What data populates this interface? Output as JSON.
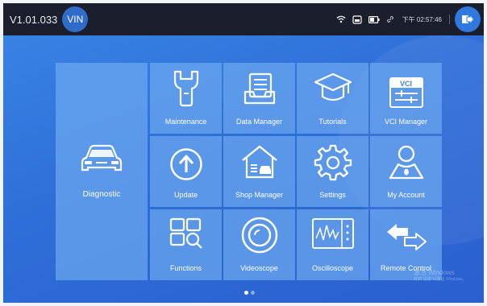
{
  "header": {
    "version": "V1.01.033",
    "vin_label": "VIN",
    "clock": "下午 02:57:46",
    "status_icons": [
      "wifi-icon",
      "storage-icon",
      "battery-icon",
      "link-icon"
    ],
    "exit_icon": "exit-icon"
  },
  "tiles": {
    "diagnostic": "Diagnostic",
    "maintenance": "Maintenance",
    "data_manager": "Data Manager",
    "tutorials": "Tutorials",
    "vci_manager": "VCI Manager",
    "vci_badge": "VCI",
    "update": "Update",
    "shop_manager": "Shop Manager",
    "settings": "Settings",
    "my_account": "My Account",
    "functions": "Functions",
    "videoscope": "Videoscope",
    "oscilloscope": "Oscilloscope",
    "remote_control": "Remote Control"
  },
  "pager": {
    "total_pages": 2,
    "current_page": 1
  },
  "watermark": {
    "line1": "激活 Windows",
    "line2": "转到\"设置\"以激活 Windows。"
  },
  "colors": {
    "topbar": "#1b1f2d",
    "accent": "#2f78e0",
    "tile": "#6ca7f0"
  }
}
